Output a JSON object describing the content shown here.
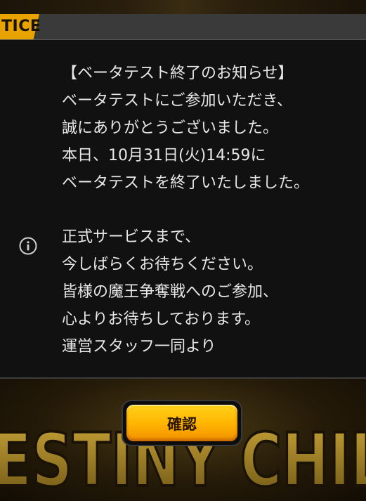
{
  "header": {
    "title": "TICE"
  },
  "notice": {
    "lines": [
      "【ベータテスト終了のお知らせ】",
      "ベータテストにご参加いただき、",
      "誠にありがとうございました。",
      "本日、10月31日(火)14:59に",
      "ベータテストを終了いたしました。",
      "",
      "正式サービスまで、",
      "今しばらくお待ちください。",
      "皆様の魔王争奪戦へのご参加、",
      "心よりお待ちしております。",
      "運営スタッフ一同より"
    ]
  },
  "icons": {
    "info": "info-circle-icon"
  },
  "buttons": {
    "confirm_label": "確認"
  },
  "background": {
    "logo_text": "ESTINY CHIL"
  },
  "colors": {
    "accent": "#e8a300",
    "panel": "#111111",
    "text": "#e8e8e8",
    "button_top": "#ffd21a",
    "button_bottom": "#f08e00"
  }
}
